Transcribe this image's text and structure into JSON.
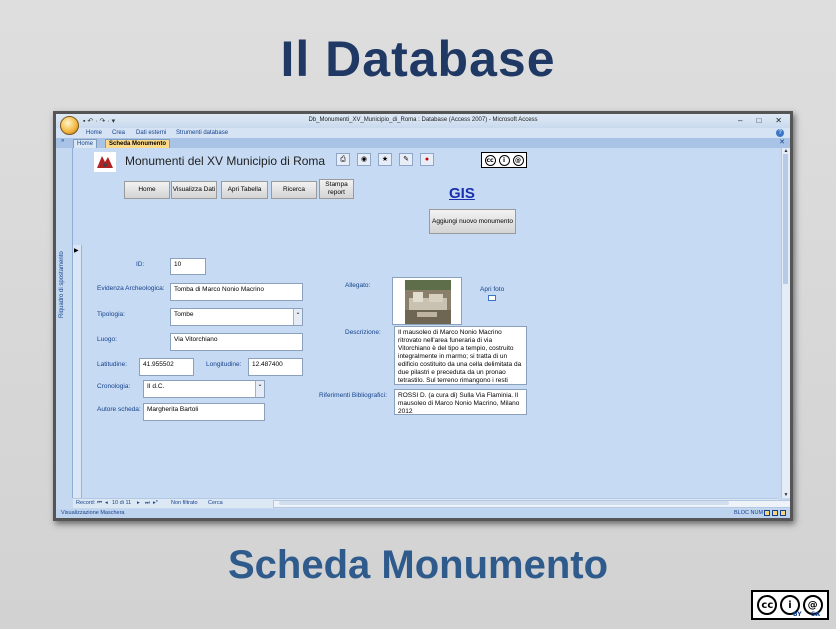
{
  "slide": {
    "title": "Il Database",
    "subtitle": "Scheda Monumento",
    "cc_badge": {
      "c1": "cc",
      "c2": "i",
      "c3": "@",
      "by": "BY",
      "sa": "SA"
    }
  },
  "window": {
    "title": "Db_Monumenti_XV_Municipio_di_Roma : Database (Access 2007) - Microsoft Access",
    "qat": "▪ ↶ · ↷ · ▾",
    "buttons": {
      "minimize": "–",
      "maximize": "□",
      "close": "✕"
    },
    "ribbon_tabs": [
      "Home",
      "Crea",
      "Dati esterni",
      "Strumenti database"
    ],
    "help": "?",
    "doc_tabs": {
      "home": "Home",
      "active": "Scheda Monumento",
      "close": "✕",
      "nav_arrows": "»"
    },
    "nav_pane_label": "Riquadro di spostamento"
  },
  "form": {
    "title": "Monumenti del XV Municipio di Roma",
    "toolbar_icons": [
      "printer-icon",
      "save-icon",
      "new-record-icon",
      "edit-icon",
      "stop-icon"
    ],
    "toolbar_glyphs": [
      "⎙",
      "◉",
      "★",
      "✎",
      "●"
    ],
    "nav_buttons": {
      "home": "Home",
      "visualizza": "Visualizza Dati",
      "apri_tabella": "Apri Tabella",
      "ricerca": "Ricerca",
      "stampa": "Stampa report"
    },
    "gis_link": "GIS",
    "add_button": "Aggiungi nuovo monumento",
    "fields": {
      "id": {
        "label": "ID:",
        "value": "10"
      },
      "evidenza": {
        "label": "Evidenza Archeologica:",
        "value": "Tomba di Marco Nonio Macrino"
      },
      "tipologia": {
        "label": "Tipologia:",
        "value": "Tombe"
      },
      "luogo": {
        "label": "Luogo:",
        "value": "Via Vitorchiano"
      },
      "latitudine": {
        "label": "Latitudine:",
        "value": "41.955502"
      },
      "longitudine": {
        "label": "Longitudine:",
        "value": "12.487400"
      },
      "cronologia": {
        "label": "Cronologia:",
        "value": "II d.C."
      },
      "autore": {
        "label": "Autore scheda:",
        "value": "Margherita Bartoli"
      },
      "allegato": {
        "label": "Allegato:"
      },
      "apri_foto": "Apri foto",
      "descrizione": {
        "label": "Descrizione:",
        "value": "Il mausoleo di Marco Nonio Macrino ritrovato nell'area funeraria di via Vitorchiano è del tipo a tempio, costruito integralmente in marmo; si tratta di un edificio costituito da una cella delimitata da due pilastri e preceduta da un pronao tetrastilo. Sul terreno rimangono i resti"
      },
      "riferimenti": {
        "label": "Riferimenti Bibliografici:",
        "value": "ROSSI D. (a cura di) Sulla Via Flaminia. Il mausoleo di Marco Nonio Macrino, Milano 2012"
      }
    },
    "record_nav": {
      "label": "Record:",
      "first": "⏮",
      "prev": "◂",
      "position": "10 di 11",
      "next": "▸",
      "last": "⏭",
      "new": "▸*",
      "filter": "Non filtrato",
      "search": "Cerca"
    }
  },
  "statusbar": {
    "left": "Visualizzazione Maschera",
    "right": "BLOC NUM"
  }
}
